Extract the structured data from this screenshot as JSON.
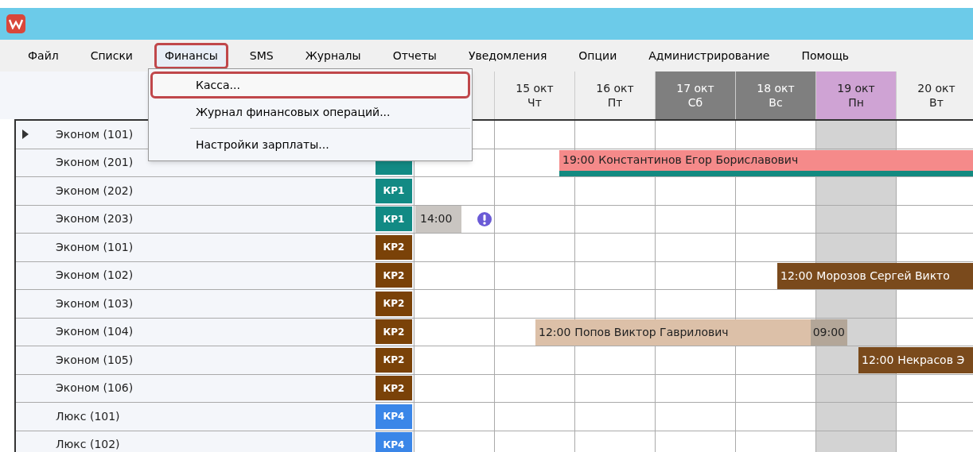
{
  "menu": [
    {
      "label": "Файл",
      "selected": false
    },
    {
      "label": "Списки",
      "selected": false
    },
    {
      "label": "Финансы",
      "selected": true
    },
    {
      "label": "SMS",
      "selected": false
    },
    {
      "label": "Журналы",
      "selected": false
    },
    {
      "label": "Отчеты",
      "selected": false
    },
    {
      "label": "Уведомления",
      "selected": false
    },
    {
      "label": "Опции",
      "selected": false
    },
    {
      "label": "Администрирование",
      "selected": false
    },
    {
      "label": "Помощь",
      "selected": false
    }
  ],
  "dropdown": {
    "groups": [
      {
        "items": [
          {
            "label": "Касса...",
            "selected": true
          },
          {
            "label": "Журнал финансовых операций...",
            "selected": false
          }
        ]
      },
      {
        "items": [
          {
            "label": "Настройки зарплаты...",
            "selected": false
          }
        ]
      }
    ]
  },
  "days": [
    {
      "kind": "normal"
    },
    {
      "date": "15 окт",
      "weekday": "Чт",
      "kind": "normal"
    },
    {
      "date": "16 окт",
      "weekday": "Пт",
      "kind": "normal"
    },
    {
      "date": "17 окт",
      "weekday": "Сб",
      "kind": "weekend"
    },
    {
      "date": "18 окт",
      "weekday": "Вс",
      "kind": "weekend"
    },
    {
      "date": "19 окт",
      "weekday": "Пн",
      "kind": "today"
    },
    {
      "date": "20 окт",
      "weekday": "Вт",
      "kind": "normal"
    }
  ],
  "rows": [
    {
      "room": "Эконом (101)",
      "current": true,
      "bookings": []
    },
    {
      "room": "Эконом (201)",
      "color": "#128a84",
      "current": false,
      "bookings": [
        {
          "kind": "stay",
          "time": "19:00",
          "name": "Константинов Егор Бориславович",
          "color": "#f58a8a"
        }
      ]
    },
    {
      "room": "Эконом (202)",
      "tag": "КР1",
      "color": "#128a84",
      "current": false,
      "bookings": []
    },
    {
      "room": "Эконом (203)",
      "tag": "КР1",
      "color": "#128a84",
      "current": false,
      "bookings": [
        {
          "kind": "pending",
          "time": "14:00",
          "color": "#c9c5c1"
        }
      ]
    },
    {
      "room": "Эконом (101)",
      "tag": "КР2",
      "color": "#7a4208",
      "current": false,
      "bookings": []
    },
    {
      "room": "Эконом (102)",
      "tag": "КР2",
      "color": "#7a4208",
      "current": false,
      "bookings": [
        {
          "kind": "stay",
          "time": "12:00",
          "name": "Морозов Сергей Викто",
          "color": "#7a4a1c"
        }
      ]
    },
    {
      "room": "Эконом (103)",
      "tag": "КР2",
      "color": "#7a4208",
      "current": false,
      "bookings": []
    },
    {
      "room": "Эконом (104)",
      "tag": "КР2",
      "color": "#7a4208",
      "current": false,
      "bookings": [
        {
          "kind": "stay",
          "time": "12:00",
          "name": "Попов Виктор Гаврилович",
          "end_time": "09:00",
          "color": "#dcc0a8"
        }
      ]
    },
    {
      "room": "Эконом (105)",
      "tag": "КР2",
      "color": "#7a4208",
      "current": false,
      "bookings": [
        {
          "kind": "stay",
          "time": "12:00",
          "name": "Некрасов Э",
          "color": "#7a4a1c"
        }
      ]
    },
    {
      "room": "Эконом (106)",
      "tag": "КР2",
      "color": "#7a4208",
      "current": false,
      "bookings": []
    },
    {
      "room": "Люкс (101)",
      "tag": "КР4",
      "color": "#3a86e8",
      "current": false,
      "bookings": []
    },
    {
      "room": "Люкс (102)",
      "tag": "КР4",
      "color": "#3a86e8",
      "current": false,
      "bookings": []
    }
  ]
}
